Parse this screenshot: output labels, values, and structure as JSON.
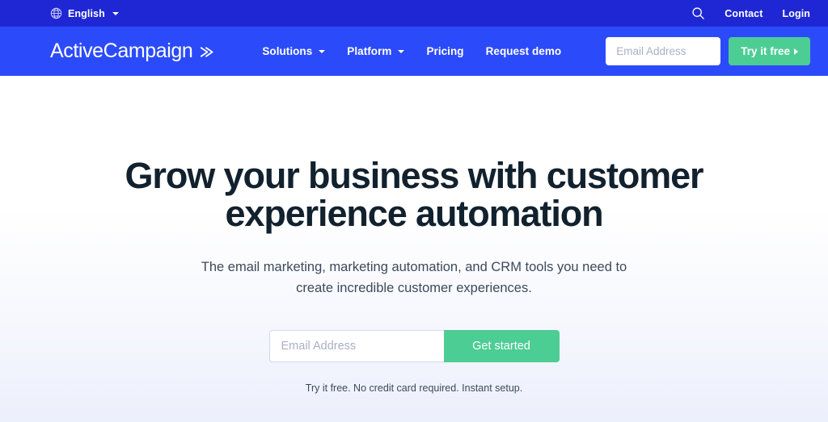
{
  "topbar": {
    "language": {
      "icon": "globe-icon",
      "label": "English",
      "caret": "chevron-down-icon"
    },
    "search_icon": "search-icon",
    "links": [
      {
        "label": "Contact"
      },
      {
        "label": "Login"
      }
    ]
  },
  "navbar": {
    "logo": {
      "text": "ActiveCampaign",
      "mark": "double-chevron-icon"
    },
    "links": [
      {
        "label": "Solutions",
        "has_dropdown": true
      },
      {
        "label": "Platform",
        "has_dropdown": true
      },
      {
        "label": "Pricing",
        "has_dropdown": false
      },
      {
        "label": "Request demo",
        "has_dropdown": false
      }
    ],
    "email_input": {
      "placeholder": "Email Address",
      "value": ""
    },
    "cta": {
      "label": "Try it free",
      "arrow": "caret-right-icon"
    }
  },
  "hero": {
    "title": "Grow your business with customer experience automation",
    "subtitle": "The email marketing, marketing automation, and CRM tools you need to create incredible customer experiences.",
    "email_input": {
      "placeholder": "Email Address",
      "value": ""
    },
    "cta": {
      "label": "Get started"
    },
    "note": "Try it free. No credit card required. Instant setup."
  },
  "colors": {
    "topbar_blue": "#1f27d4",
    "nav_blue": "#2b4bfa",
    "accent_green": "#4ccd94",
    "headline_navy": "#12212e",
    "body_text": "#3c4a5c",
    "hero_gradient_end": "#eceffc"
  }
}
